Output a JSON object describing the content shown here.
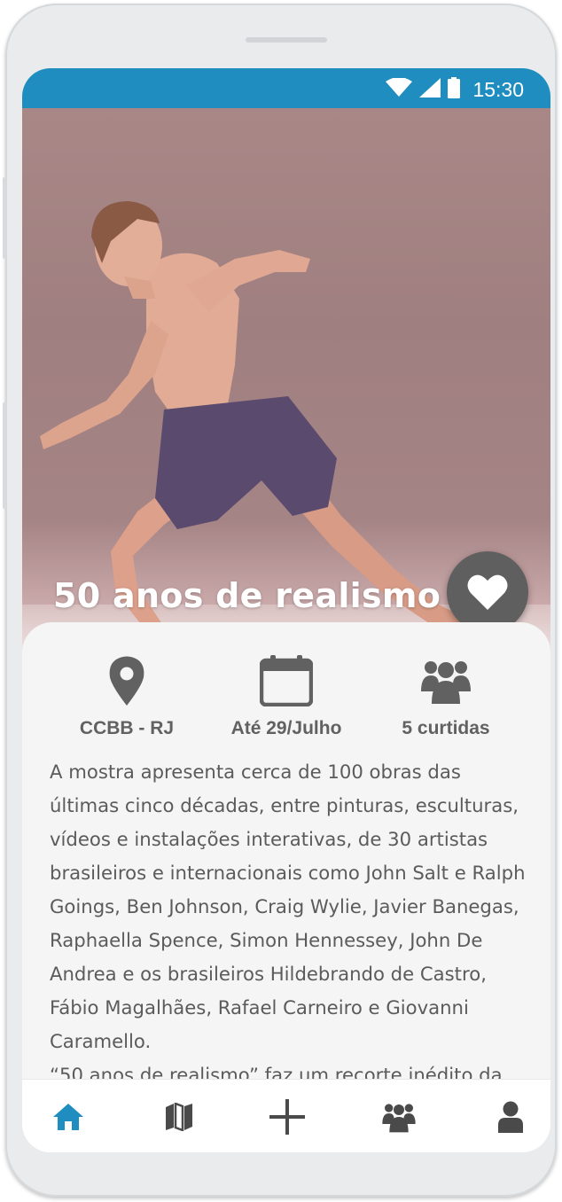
{
  "status_bar": {
    "time": "15:30",
    "icons": [
      "wifi-icon",
      "signal-icon",
      "battery-icon"
    ],
    "background": "#1f8dbf"
  },
  "event": {
    "title": "50 anos de realismo",
    "favorite_icon": "heart-icon",
    "location": {
      "icon": "location-pin-icon",
      "label": "CCBB - RJ"
    },
    "date": {
      "icon": "calendar-icon",
      "label": "Até 29/Julho"
    },
    "likes": {
      "icon": "group-icon",
      "label": "5 curtidas"
    },
    "description_paragraphs": [
      "A mostra apresenta cerca de 100 obras das últimas cinco décadas, entre pinturas, esculturas, vídeos e instalações interativas, de 30 artistas brasileiros e internacionais como John Salt e Ralph Goings, Ben Johnson, Craig Wylie, Javier Banegas, Raphaella Spence, Simon Hennessey, John De Andrea e os brasileiros Hildebrando de Castro, Fábio Magalhães, Rafael Carneiro e Giovanni Caramello.",
      "“50 anos de realismo” faz um recorte inédito da"
    ]
  },
  "bottom_nav": {
    "items": [
      {
        "icon": "home-icon",
        "active": true
      },
      {
        "icon": "map-icon",
        "active": false
      },
      {
        "icon": "plus-icon",
        "active": false
      },
      {
        "icon": "group-icon",
        "active": false
      },
      {
        "icon": "person-icon",
        "active": false
      }
    ],
    "active_color": "#1f8dbf",
    "inactive_color": "#4a4a4a"
  }
}
